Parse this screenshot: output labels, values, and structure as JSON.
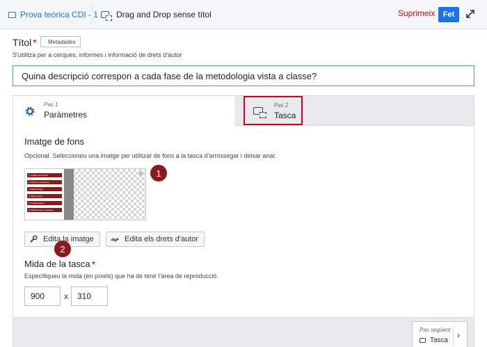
{
  "breadcrumb": {
    "course": "Prova teòrica CDI - 1",
    "content": "Drag and Drop sense títol"
  },
  "toolbar": {
    "delete_label": "Suprimeix",
    "done_label": "Fet",
    "expand_icon": "expand-icon"
  },
  "title_field": {
    "label": "Títol",
    "required_mark": "*",
    "metadata_label": "Metadades",
    "help": "S'utilitza per a cerques, informes i informació de drets d'autor",
    "value": "Quina descripció correspon a cada fase de la metodologia vista a classe?"
  },
  "steps": [
    {
      "sub": "Pas 1",
      "label": "Paràmetres",
      "icon": "gear-icon"
    },
    {
      "sub": "Pas 2",
      "label": "Tasca",
      "icon": "drag-drop-icon"
    }
  ],
  "background_image": {
    "title": "Imatge de fons",
    "help": "Opcional. Seleccioneu una imatge per utilitzar de fons a la tasca d'arrossegar i deixar anar.",
    "edit_image_label": "Edita la imatge",
    "edit_rights_label": "Edita els drets d'autor",
    "thumbnail_items": [
      "1. Anàlisi de requisits",
      "2. Disseny conceptual",
      "3. Disseny lògic",
      "4. Disseny físic",
      "5. Implementació",
      "6. Manteniment i avaluació"
    ]
  },
  "task_size": {
    "title": "Mida de la tasca",
    "required_mark": "*",
    "help": "Especifiqueu la mida (en píxels) que ha de tenir l'àrea de reproducció.",
    "width": "900",
    "times": "x",
    "height": "310"
  },
  "markers": [
    "1",
    "2"
  ],
  "footer": {
    "next_sub": "Pas següent",
    "next_label": "Tasca",
    "next_chevron": "›"
  },
  "colors": {
    "accent": "#1a73e8",
    "danger": "#d0021b",
    "marker": "#8b1a1a"
  }
}
